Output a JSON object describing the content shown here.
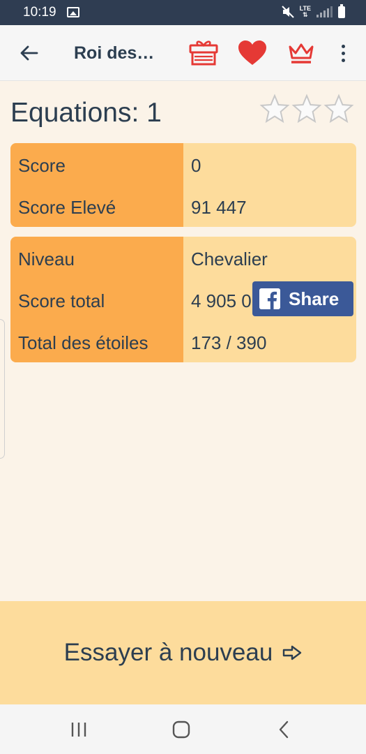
{
  "status_bar": {
    "time": "10:19",
    "lte_label": "LTE",
    "icons": [
      "image-icon",
      "mute-icon",
      "lte-data-icon",
      "signal-icon",
      "battery-icon"
    ]
  },
  "app_bar": {
    "title": "Roi des…",
    "icons": [
      "back-arrow-icon",
      "gift-icon",
      "heart-icon",
      "crown-icon",
      "more-vert-icon"
    ],
    "accent_color": "#e53935"
  },
  "level": {
    "title": "Equations: 1",
    "stars_earned": 0,
    "stars_total": 3
  },
  "score_card": {
    "rows": [
      {
        "label": "Score",
        "value": "0"
      },
      {
        "label": "Score Elevé",
        "value": "91 447"
      }
    ]
  },
  "profile_card": {
    "rows": [
      {
        "label": "Niveau",
        "value": "Chevalier"
      },
      {
        "label": "Score total",
        "value": "4 905 0"
      },
      {
        "label": "Total des étoiles",
        "value": "173 / 390"
      }
    ]
  },
  "share_button": {
    "label": "Share",
    "color": "#3b5998"
  },
  "retry_button": {
    "label": "Essayer à nouveau",
    "icon": "arrow-right-outline-icon"
  },
  "colors": {
    "background": "#fbf3e8",
    "label_column": "#fbab4d",
    "value_column": "#fddc9c",
    "text": "#2c3e50"
  },
  "nav_bar": {
    "icons": [
      "recents-icon",
      "home-icon",
      "back-icon"
    ]
  }
}
